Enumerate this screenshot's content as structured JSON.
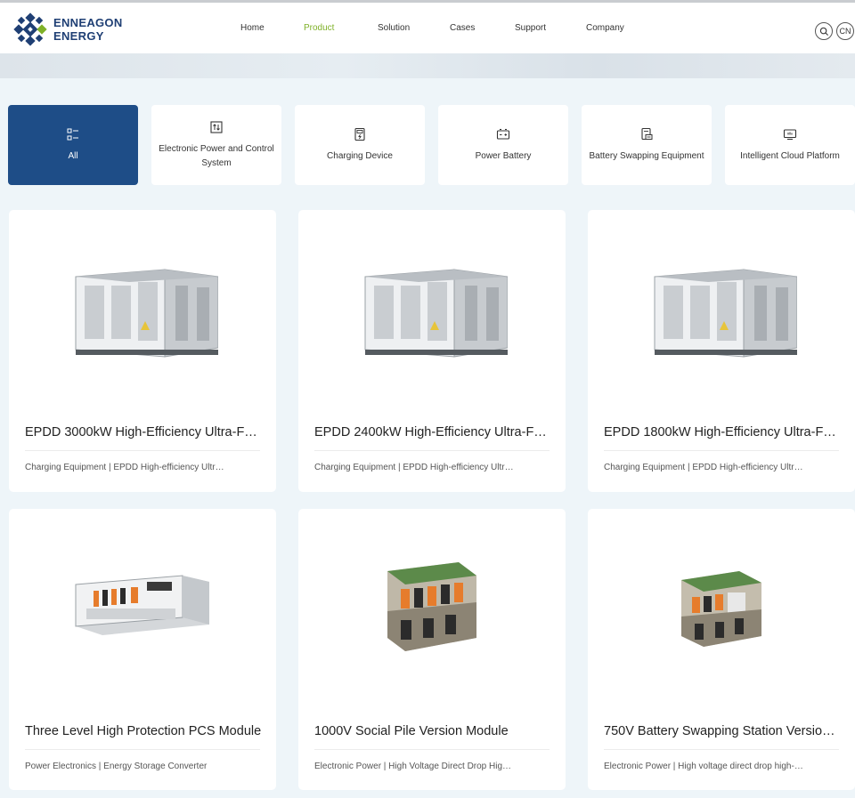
{
  "brand": {
    "line1": "ENNEAGON",
    "line2": "ENERGY"
  },
  "nav": [
    {
      "label": "Home",
      "active": false
    },
    {
      "label": "Product",
      "active": true
    },
    {
      "label": "Solution",
      "active": false
    },
    {
      "label": "Cases",
      "active": false
    },
    {
      "label": "Support",
      "active": false
    },
    {
      "label": "Company",
      "active": false
    }
  ],
  "header_actions": {
    "search_icon": "search-icon",
    "lang": "CN"
  },
  "colors": {
    "accent_green": "#7fb128",
    "brand_blue": "#1e4d87",
    "background": "#eef5f9"
  },
  "categories": [
    {
      "label": "All",
      "icon": "list-icon",
      "active": true
    },
    {
      "label": "Electronic Power and Control System",
      "icon": "power-control-icon",
      "active": false
    },
    {
      "label": "Charging Device",
      "icon": "charging-device-icon",
      "active": false
    },
    {
      "label": "Power Battery",
      "icon": "battery-icon",
      "active": false
    },
    {
      "label": "Battery Swapping Equipment",
      "icon": "battery-swap-icon",
      "active": false
    },
    {
      "label": "Intelligent Cloud Platform",
      "icon": "cloud-platform-icon",
      "active": false
    }
  ],
  "products": [
    {
      "title": "EPDD 3000kW High-Efficiency Ultra-F…",
      "desc": "Charging Equipment | EPDD High-efficiency Ultr…",
      "image": "container-cabinet"
    },
    {
      "title": "EPDD 2400kW High-Efficiency Ultra-F…",
      "desc": "Charging Equipment | EPDD High-efficiency Ultr…",
      "image": "container-cabinet"
    },
    {
      "title": "EPDD 1800kW High-Efficiency Ultra-F…",
      "desc": "Charging Equipment | EPDD High-efficiency Ultr…",
      "image": "container-cabinet"
    },
    {
      "title": "Three Level High Protection PCS Module",
      "desc": "Power Electronics | Energy Storage Converter",
      "image": "rack-module"
    },
    {
      "title": "1000V Social Pile Version Module",
      "desc": "Electronic Power | High Voltage Direct Drop Hig…",
      "image": "open-module"
    },
    {
      "title": "750V Battery Swapping Station Versio…",
      "desc": "Electronic Power | High voltage direct drop high-…",
      "image": "open-module-small"
    }
  ]
}
